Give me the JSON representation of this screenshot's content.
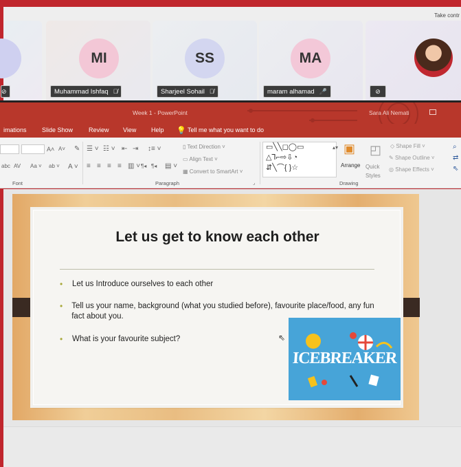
{
  "meeting": {
    "take_control": "Take contr",
    "participants": [
      {
        "initials": "",
        "name": "",
        "color": "#cfd0f0"
      },
      {
        "initials": "MI",
        "name": "Muhammad Ishfaq",
        "color": "#f3c7d6"
      },
      {
        "initials": "SS",
        "name": "Sharjeel Sohail",
        "color": "#d3d6f0"
      },
      {
        "initials": "MA",
        "name": "maram alhamad",
        "color": "#f3c8d8"
      },
      {
        "initials": "",
        "name": "",
        "color": "#c02830"
      }
    ]
  },
  "powerpoint": {
    "doc_title": "Week 1  -  PowerPoint",
    "user": "Sara Ali Nemati",
    "tabs": [
      "imations",
      "Slide Show",
      "Review",
      "View",
      "Help"
    ],
    "tell_me": "Tell me what you want to do",
    "ribbon": {
      "font_group": "Font",
      "paragraph_group": "Paragraph",
      "drawing_group": "Drawing",
      "text_direction": "Text Direction",
      "align_text": "Align Text",
      "convert_smartart": "Convert to SmartArt",
      "arrange": "Arrange",
      "quick_styles": "Quick Styles",
      "shape_fill": "Shape Fill",
      "shape_outline": "Shape Outline",
      "shape_effects": "Shape Effects"
    }
  },
  "slide": {
    "title": "Let us get to know each other",
    "bullets": [
      "Let us Introduce ourselves to each other",
      "Tell us your name, background (what you studied before), favourite place/food, any fun fact about you.",
      "What is your favourite subject?"
    ],
    "image_text": "ICEBREAKER"
  }
}
